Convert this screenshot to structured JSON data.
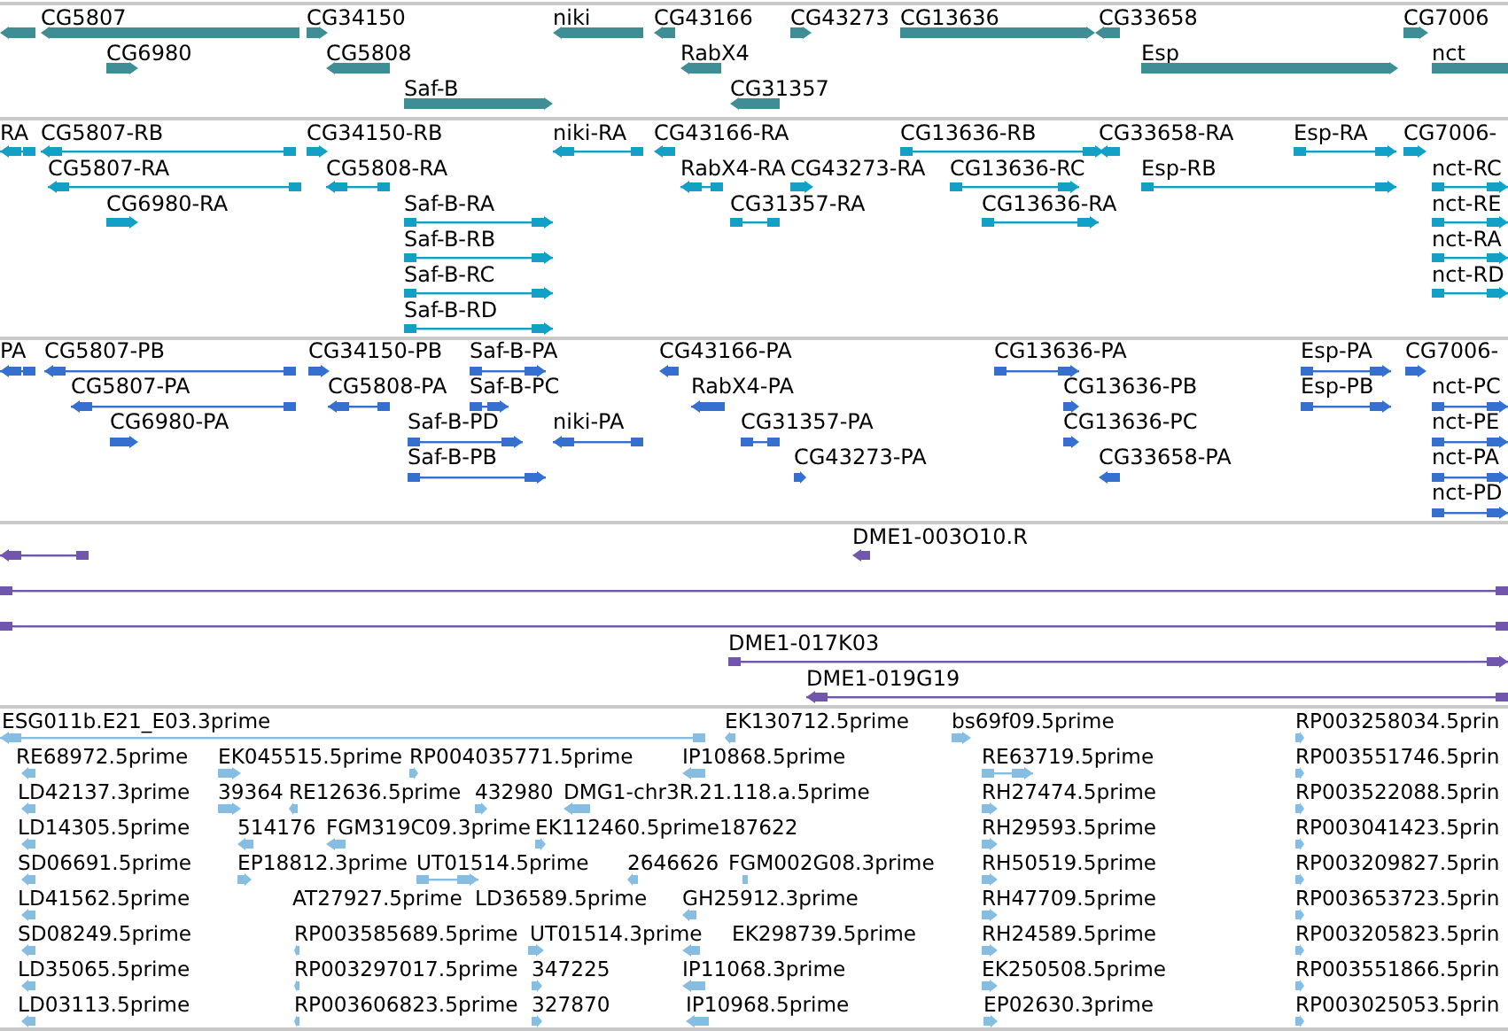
{
  "tracks": [
    {
      "kind": "gene",
      "features": [
        {
          "kind": "reverse"
        },
        {
          "label": "CG5807",
          "kind": "reverse"
        },
        {
          "label": "CG34150",
          "kind": "forward"
        },
        {
          "label": "niki",
          "kind": "reverse"
        },
        {
          "label": "CG43166",
          "kind": "reverse"
        },
        {
          "label": "CG43273",
          "kind": "forward"
        },
        {
          "label": "CG13636",
          "kind": "forward"
        },
        {
          "label": "CG33658",
          "kind": "reverse"
        },
        {
          "label": "CG7006",
          "kind": "forward"
        },
        {
          "label": "CG6980",
          "kind": "forward"
        },
        {
          "label": "CG5808",
          "kind": "reverse"
        },
        {
          "label": "RabX4",
          "kind": "reverse"
        },
        {
          "label": "Esp",
          "kind": "forward"
        },
        {
          "label": "nct",
          "kind": "blunt"
        },
        {
          "label": "Saf-B",
          "kind": "forward"
        },
        {
          "label": "CG31357",
          "kind": "reverse"
        }
      ]
    },
    {
      "kind": "transcript",
      "features": [
        {
          "label": "RA",
          "kind": "reverse"
        },
        {
          "label": "CG5807-RB",
          "kind": "reverse"
        },
        {
          "label": "CG34150-RB",
          "kind": "forward"
        },
        {
          "label": "niki-RA",
          "kind": "reverse"
        },
        {
          "label": "CG43166-RA",
          "kind": "reverse"
        },
        {
          "label": "CG13636-RB",
          "kind": "forward"
        },
        {
          "label": "CG33658-RA",
          "kind": "reverse"
        },
        {
          "label": "Esp-RA",
          "kind": "forward"
        },
        {
          "label": "CG7006-",
          "kind": "forward"
        },
        {
          "label": "CG5807-RA",
          "kind": "reverse"
        },
        {
          "label": "CG5808-RA",
          "kind": "reverse"
        },
        {
          "label": "RabX4-RA",
          "kind": "reverse"
        },
        {
          "label": "CG43273-RA",
          "kind": "forward"
        },
        {
          "label": "CG13636-RC",
          "kind": "forward"
        },
        {
          "label": "Esp-RB",
          "kind": "forward"
        },
        {
          "label": "nct-RC",
          "kind": "forward"
        },
        {
          "label": "CG6980-RA",
          "kind": "forward"
        },
        {
          "label": "Saf-B-RA",
          "kind": "forward"
        },
        {
          "label": "CG31357-RA",
          "kind": "blunt"
        },
        {
          "label": "CG13636-RA",
          "kind": "forward"
        },
        {
          "label": "nct-RE",
          "kind": "forward"
        },
        {
          "label": "Saf-B-RB",
          "kind": "forward"
        },
        {
          "label": "nct-RA",
          "kind": "forward"
        },
        {
          "label": "Saf-B-RC",
          "kind": "forward"
        },
        {
          "label": "nct-RD",
          "kind": "forward"
        },
        {
          "label": "Saf-B-RD",
          "kind": "forward"
        }
      ]
    },
    {
      "kind": "protein",
      "features": [
        {
          "label": "PA",
          "kind": "reverse"
        },
        {
          "label": "CG5807-PB",
          "kind": "reverse"
        },
        {
          "label": "CG34150-PB",
          "kind": "forward"
        },
        {
          "label": "Saf-B-PA",
          "kind": "forward"
        },
        {
          "label": "CG43166-PA",
          "kind": "reverse"
        },
        {
          "label": "CG13636-PA",
          "kind": "forward"
        },
        {
          "label": "Esp-PA",
          "kind": "forward"
        },
        {
          "label": "CG7006-",
          "kind": "forward"
        },
        {
          "label": "CG5807-PA",
          "kind": "reverse"
        },
        {
          "label": "CG5808-PA",
          "kind": "reverse"
        },
        {
          "label": "Saf-B-PC",
          "kind": "forward"
        },
        {
          "label": "RabX4-PA",
          "kind": "reverse"
        },
        {
          "label": "CG13636-PB",
          "kind": "forward"
        },
        {
          "label": "Esp-PB",
          "kind": "forward"
        },
        {
          "label": "nct-PC",
          "kind": "forward"
        },
        {
          "label": "CG6980-PA",
          "kind": "forward"
        },
        {
          "label": "Saf-B-PD",
          "kind": "forward"
        },
        {
          "label": "niki-PA",
          "kind": "reverse"
        },
        {
          "label": "CG31357-PA",
          "kind": "blunt"
        },
        {
          "label": "CG13636-PC",
          "kind": "forward"
        },
        {
          "label": "nct-PE",
          "kind": "forward"
        },
        {
          "label": "Saf-B-PB",
          "kind": "forward"
        },
        {
          "label": "CG43273-PA",
          "kind": "forward"
        },
        {
          "label": "CG33658-PA",
          "kind": "reverse"
        },
        {
          "label": "nct-PA",
          "kind": "forward"
        },
        {
          "label": "nct-PD",
          "kind": "forward"
        }
      ]
    },
    {
      "kind": "clone",
      "features": [
        {
          "kind": "reverse"
        },
        {
          "label": "DME1-003O10.R",
          "kind": "reverse"
        },
        {
          "kind": "blunt"
        },
        {
          "kind": "blunt"
        },
        {
          "label": "DME1-017K03",
          "kind": "forward"
        },
        {
          "label": "DME1-019G19",
          "kind": "reverse"
        }
      ]
    },
    {
      "kind": "est",
      "features": [
        {
          "label": "ESG011b.E21_E03.3prime",
          "kind": "reverse"
        },
        {
          "label": "EK130712.5prime",
          "kind": "reverse"
        },
        {
          "label": "bs69f09.5prime",
          "kind": "forward"
        },
        {
          "label": "RP003258034.5prin",
          "kind": "forward"
        },
        {
          "label": "RE68972.5prime",
          "kind": "reverse"
        },
        {
          "label": "EK045515.5prime",
          "kind": "forward"
        },
        {
          "label": "RP004035771.5prime",
          "kind": "forward"
        },
        {
          "label": "IP10868.5prime",
          "kind": "reverse"
        },
        {
          "label": "RE63719.5prime",
          "kind": "forward"
        },
        {
          "label": "RP003551746.5prin",
          "kind": "forward"
        },
        {
          "label": "LD42137.3prime",
          "kind": "reverse"
        },
        {
          "label": "39364",
          "kind": "forward"
        },
        {
          "label": "RE12636.5prime",
          "kind": "reverse"
        },
        {
          "label": "432980",
          "kind": "forward"
        },
        {
          "label": "DMG1-chr3R.21.118.a.5prime",
          "kind": "reverse"
        },
        {
          "label": "RH27474.5prime",
          "kind": "forward"
        },
        {
          "label": "RP003522088.5prin",
          "kind": "forward"
        },
        {
          "label": "LD14305.5prime",
          "kind": "reverse"
        },
        {
          "label": "514176",
          "kind": "reverse"
        },
        {
          "label": "FGM319C09.3prime",
          "kind": "reverse"
        },
        {
          "label": "EK112460.5prime",
          "kind": "forward"
        },
        {
          "label": "187622"
        },
        {
          "label": "RH29593.5prime",
          "kind": "forward"
        },
        {
          "label": "RP003041423.5prin",
          "kind": "forward"
        },
        {
          "label": "SD06691.5prime",
          "kind": "reverse"
        },
        {
          "label": "EP18812.3prime",
          "kind": "forward"
        },
        {
          "label": "UT01514.5prime",
          "kind": "forward"
        },
        {
          "label": "2646626",
          "kind": "reverse"
        },
        {
          "label": "FGM002G08.3prime",
          "kind": "blunt"
        },
        {
          "label": "RH50519.5prime",
          "kind": "forward"
        },
        {
          "label": "RP003209827.5prin",
          "kind": "forward"
        },
        {
          "label": "LD41562.5prime",
          "kind": "reverse"
        },
        {
          "label": "AT27927.5prime"
        },
        {
          "label": "LD36589.5prime"
        },
        {
          "label": "GH25912.3prime",
          "kind": "reverse"
        },
        {
          "label": "RH47709.5prime",
          "kind": "forward"
        },
        {
          "label": "RP003653723.5prin",
          "kind": "forward"
        },
        {
          "label": "SD08249.5prime",
          "kind": "reverse"
        },
        {
          "label": "RP003585689.5prime",
          "kind": "reverse"
        },
        {
          "label": "UT01514.3prime",
          "kind": "forward"
        },
        {
          "label": "EK298739.5prime",
          "kind": "reverse"
        },
        {
          "label": "RH24589.5prime",
          "kind": "forward"
        },
        {
          "label": "RP003205823.5prin",
          "kind": "forward"
        },
        {
          "label": "LD35065.5prime",
          "kind": "reverse"
        },
        {
          "label": "RP003297017.5prime",
          "kind": "reverse"
        },
        {
          "label": "347225",
          "kind": "forward"
        },
        {
          "label": "IP11068.3prime",
          "kind": "reverse"
        },
        {
          "label": "EK250508.5prime",
          "kind": "forward"
        },
        {
          "label": "RP003551866.5prin",
          "kind": "forward"
        },
        {
          "label": "LD03113.5prime",
          "kind": "reverse"
        },
        {
          "label": "RP003606823.5prime",
          "kind": "reverse"
        },
        {
          "label": "327870",
          "kind": "forward"
        },
        {
          "label": "IP10968.5prime",
          "kind": "reverse"
        },
        {
          "label": "EP02630.3prime",
          "kind": "forward"
        },
        {
          "label": "RP003025053.5prin",
          "kind": "forward"
        }
      ]
    }
  ]
}
